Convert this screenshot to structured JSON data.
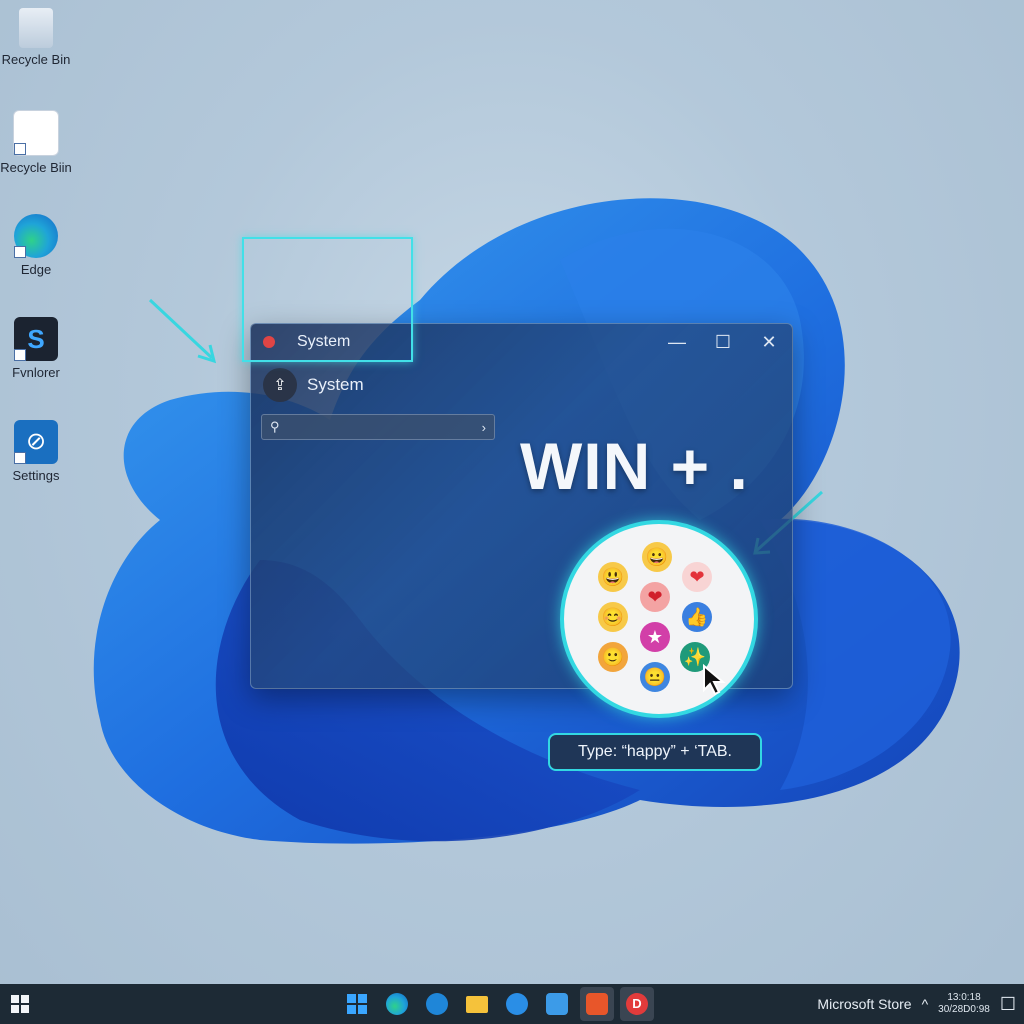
{
  "desktop": {
    "icons": [
      {
        "label": "Recycle Bin",
        "icon": "recycle-bin-icon"
      },
      {
        "label": "Recycle Biin",
        "icon": "recycle-app-icon"
      },
      {
        "label": "Edge",
        "icon": "edge-icon"
      },
      {
        "label": "Fvnlorer",
        "icon": "explorer-icon"
      },
      {
        "label": "Settings",
        "icon": "settings-icon"
      }
    ]
  },
  "window": {
    "title": "System",
    "app_name": "System",
    "controls": {
      "minimize": "—",
      "maximize": "☐",
      "close": "✕"
    },
    "search": {
      "icon": "search-icon",
      "chevron": "›"
    }
  },
  "overlay": {
    "shortcut_text": "WIN + .",
    "tip": "Type: “happy” + ‘TAB.",
    "accent_color": "#33d8e2"
  },
  "emoji_picker": {
    "items": [
      "😀",
      "😃",
      "❤",
      "😊",
      "❤",
      "👍",
      "🙂",
      "★",
      "✨",
      "😐"
    ]
  },
  "taskbar": {
    "right_label": "Microsoft Store",
    "clock_line1": "13:0:18",
    "clock_line2": "30/28D0:98",
    "tray_icon": "^",
    "notification_icon": "☐"
  }
}
